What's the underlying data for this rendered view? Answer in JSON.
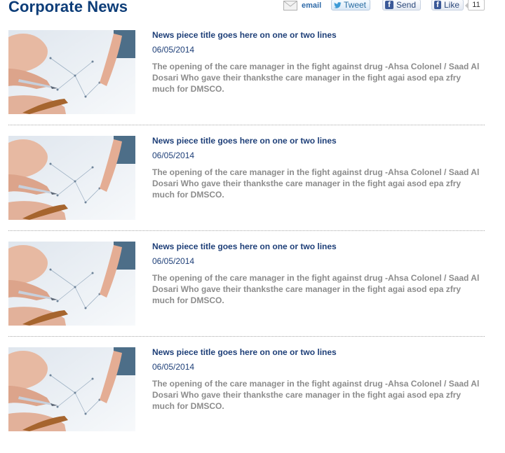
{
  "page": {
    "title": "Corporate News"
  },
  "share": {
    "email_label": "email",
    "tweet_label": "Tweet",
    "send_label": "Send",
    "like_label": "Like",
    "like_count": "11",
    "icons": {
      "email": "envelope-icon",
      "tweet": "twitter-bird-icon",
      "facebook": "facebook-icon"
    }
  },
  "colors": {
    "title": "#0d3d78",
    "link": "#1e3f78",
    "excerpt": "#8c8c8c",
    "facebook": "#3b5998"
  },
  "news": [
    {
      "title": "News piece title goes here on one or two lines",
      "date": "06/05/2014",
      "excerpt": "The opening of the care manager in the fight against drug -Ahsa Colonel / Saad Al Dosari Who gave their thanksthe care manager in the fight agai asod epa zfry much for DMSCO."
    },
    {
      "title": "News piece title goes here on one or two lines",
      "date": "06/05/2014",
      "excerpt": "The opening of the care manager in the fight against drug -Ahsa Colonel / Saad Al Dosari Who gave their thanksthe care manager in the fight agai asod epa zfry much for DMSCO."
    },
    {
      "title": "News piece title goes here on one or two lines",
      "date": "06/05/2014",
      "excerpt": "The opening of the care manager in the fight against drug -Ahsa Colonel / Saad Al Dosari Who gave their thanksthe care manager in the fight agai asod epa zfry much for DMSCO."
    },
    {
      "title": "News piece title goes here on one or two lines",
      "date": "06/05/2014",
      "excerpt": "The opening of the care manager in the fight against drug -Ahsa Colonel / Saad Al Dosari Who gave their thanksthe care manager in the fight agai asod epa zfry much for DMSCO."
    }
  ]
}
